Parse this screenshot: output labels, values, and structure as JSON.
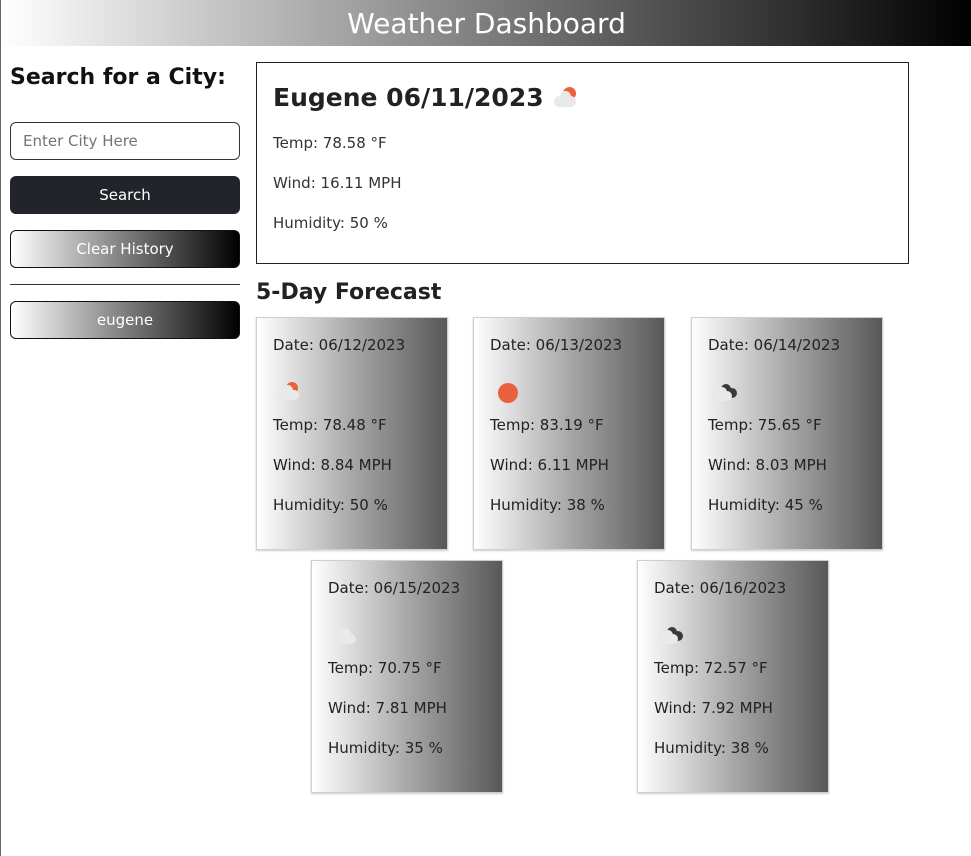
{
  "header": {
    "title": "Weather Dashboard"
  },
  "sidebar": {
    "search_title": "Search for a City:",
    "input_placeholder": "Enter City Here",
    "input_value": "",
    "search_label": "Search",
    "clear_label": "Clear History",
    "history": [
      "eugene"
    ]
  },
  "current": {
    "title": "Eugene 06/11/2023",
    "icon": "partly-cloudy-sun-icon",
    "temp": "Temp: 78.58 °F",
    "wind": "Wind: 16.11 MPH",
    "humidity": "Humidity: 50 %"
  },
  "forecast": {
    "title": "5-Day Forecast",
    "days": [
      {
        "date": "Date: 06/12/2023",
        "icon": "partly-cloudy-sun-icon",
        "temp": "Temp: 78.48 °F",
        "wind": "Wind: 8.84 MPH",
        "humidity": "Humidity: 50 %"
      },
      {
        "date": "Date: 06/13/2023",
        "icon": "sun-icon",
        "temp": "Temp: 83.19 °F",
        "wind": "Wind: 6.11 MPH",
        "humidity": "Humidity: 38 %"
      },
      {
        "date": "Date: 06/14/2023",
        "icon": "broken-clouds-icon",
        "temp": "Temp: 75.65 °F",
        "wind": "Wind: 8.03 MPH",
        "humidity": "Humidity: 45 %"
      },
      {
        "date": "Date: 06/15/2023",
        "icon": "cloud-icon",
        "temp": "Temp: 70.75 °F",
        "wind": "Wind: 7.81 MPH",
        "humidity": "Humidity: 35 %"
      },
      {
        "date": "Date: 06/16/2023",
        "icon": "broken-clouds-icon",
        "temp": "Temp: 72.57 °F",
        "wind": "Wind: 7.92 MPH",
        "humidity": "Humidity: 38 %"
      }
    ]
  },
  "colors": {
    "sun": "#e8623d",
    "search_button": "#212529"
  }
}
